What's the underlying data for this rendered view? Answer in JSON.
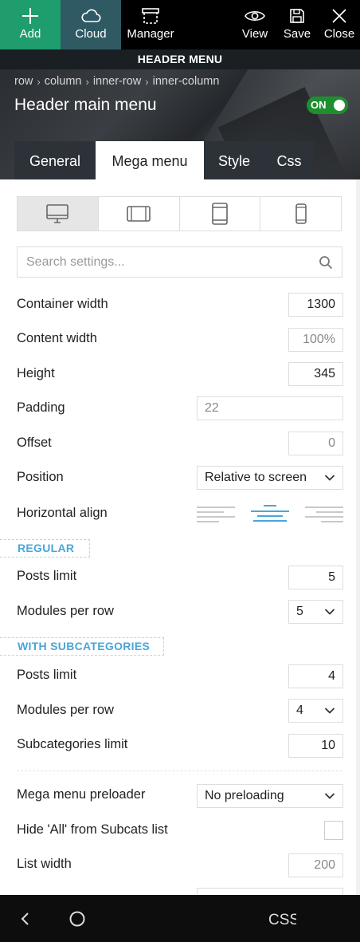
{
  "toolbar": {
    "add": "Add",
    "cloud": "Cloud",
    "manager": "Manager",
    "view": "View",
    "save": "Save",
    "close": "Close"
  },
  "menubar": {
    "title": "HEADER MENU"
  },
  "breadcrumb": [
    "row",
    "column",
    "inner-row",
    "inner-column"
  ],
  "hero": {
    "title": "Header main menu",
    "toggle": "ON"
  },
  "tabs": [
    "General",
    "Mega menu",
    "Style",
    "Css"
  ],
  "devices": [
    "desktop-icon",
    "tablet-landscape-icon",
    "tablet-portrait-icon",
    "phone-icon"
  ],
  "search": {
    "placeholder": "Search settings..."
  },
  "settings": {
    "container_width": {
      "label": "Container width",
      "value": "1300"
    },
    "content_width": {
      "label": "Content width",
      "value": "100%"
    },
    "height": {
      "label": "Height",
      "value": "345"
    },
    "padding": {
      "label": "Padding",
      "value": "22"
    },
    "offset": {
      "label": "Offset",
      "value": "0"
    },
    "position": {
      "label": "Position",
      "value": "Relative to screen"
    },
    "horizontal_align": {
      "label": "Horizontal align",
      "selected": "center"
    }
  },
  "regular": {
    "title": "REGULAR",
    "posts_limit": {
      "label": "Posts limit",
      "value": "5"
    },
    "modules_per_row": {
      "label": "Modules per row",
      "value": "5"
    }
  },
  "subcats": {
    "title": "WITH SUBCATEGORIES",
    "posts_limit": {
      "label": "Posts limit",
      "value": "4"
    },
    "modules_per_row": {
      "label": "Modules per row",
      "value": "4"
    },
    "subcategories_limit": {
      "label": "Subcategories limit",
      "value": "10"
    }
  },
  "misc": {
    "preloader": {
      "label": "Mega menu preloader",
      "value": "No preloading"
    },
    "hide_all": {
      "label": "Hide 'All' from Subcats list",
      "checked": false
    },
    "list_width": {
      "label": "List width",
      "value": "200"
    }
  },
  "navbar": {
    "css": "CSS"
  },
  "colors": {
    "accent": "#1f9d6d",
    "toggle": "#1e8f2e",
    "section": "#4aa6d8"
  }
}
